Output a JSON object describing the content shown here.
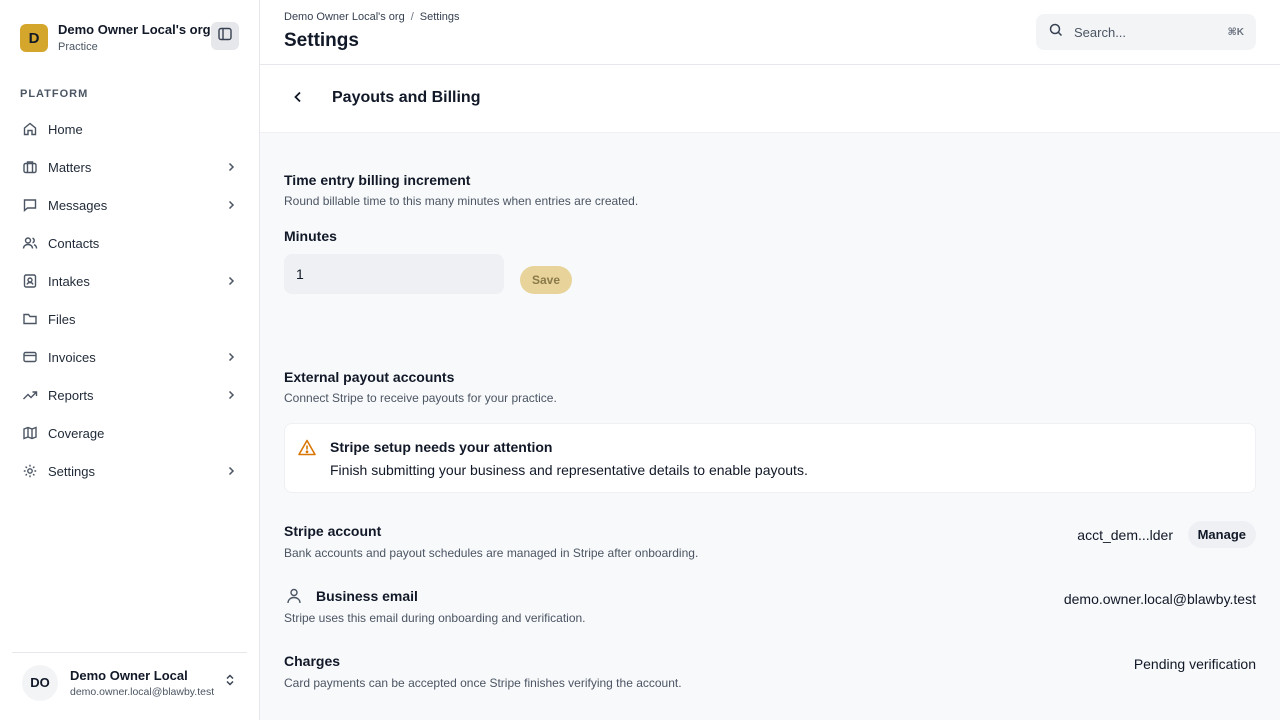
{
  "org": {
    "initial": "D",
    "name": "Demo Owner Local's org",
    "type": "Practice"
  },
  "sidebar": {
    "section_label": "PLATFORM",
    "items": [
      {
        "label": "Home",
        "icon": "home-icon",
        "has_children": false
      },
      {
        "label": "Matters",
        "icon": "briefcase-icon",
        "has_children": true
      },
      {
        "label": "Messages",
        "icon": "message-icon",
        "has_children": true
      },
      {
        "label": "Contacts",
        "icon": "users-icon",
        "has_children": false
      },
      {
        "label": "Intakes",
        "icon": "contact-card-icon",
        "has_children": true
      },
      {
        "label": "Files",
        "icon": "folder-icon",
        "has_children": false
      },
      {
        "label": "Invoices",
        "icon": "credit-card-icon",
        "has_children": true
      },
      {
        "label": "Reports",
        "icon": "trending-up-icon",
        "has_children": true
      },
      {
        "label": "Coverage",
        "icon": "map-icon",
        "has_children": false
      },
      {
        "label": "Settings",
        "icon": "gear-icon",
        "has_children": true
      }
    ]
  },
  "user": {
    "initials": "DO",
    "name": "Demo Owner Local",
    "email": "demo.owner.local@blawby.test"
  },
  "header": {
    "breadcrumb": [
      "Demo Owner Local's org",
      "Settings"
    ],
    "title": "Settings",
    "search_placeholder": "Search...",
    "search_shortcut": "⌘K"
  },
  "subheader": {
    "title": "Payouts and Billing"
  },
  "billing_increment": {
    "title": "Time entry billing increment",
    "description": "Round billable time to this many minutes when entries are created.",
    "field_label": "Minutes",
    "field_value": "1",
    "save_label": "Save"
  },
  "payouts": {
    "title": "External payout accounts",
    "description": "Connect Stripe to receive payouts for your practice.",
    "alert_title": "Stripe setup needs your attention",
    "alert_body": "Finish submitting your business and representative details to enable payouts."
  },
  "rows": {
    "stripe_account": {
      "title": "Stripe account",
      "description": "Bank accounts and payout schedules are managed in Stripe after onboarding.",
      "value": "acct_dem...lder",
      "action": "Manage"
    },
    "business_email": {
      "title": "Business email",
      "description": "Stripe uses this email during onboarding and verification.",
      "value": "demo.owner.local@blawby.test"
    },
    "charges": {
      "title": "Charges",
      "description": "Card payments can be accepted once Stripe finishes verifying the account.",
      "value": "Pending verification"
    }
  },
  "colors": {
    "accent": "#d4a72c",
    "accent_muted": "#e8d49a",
    "warning": "#d97706"
  }
}
